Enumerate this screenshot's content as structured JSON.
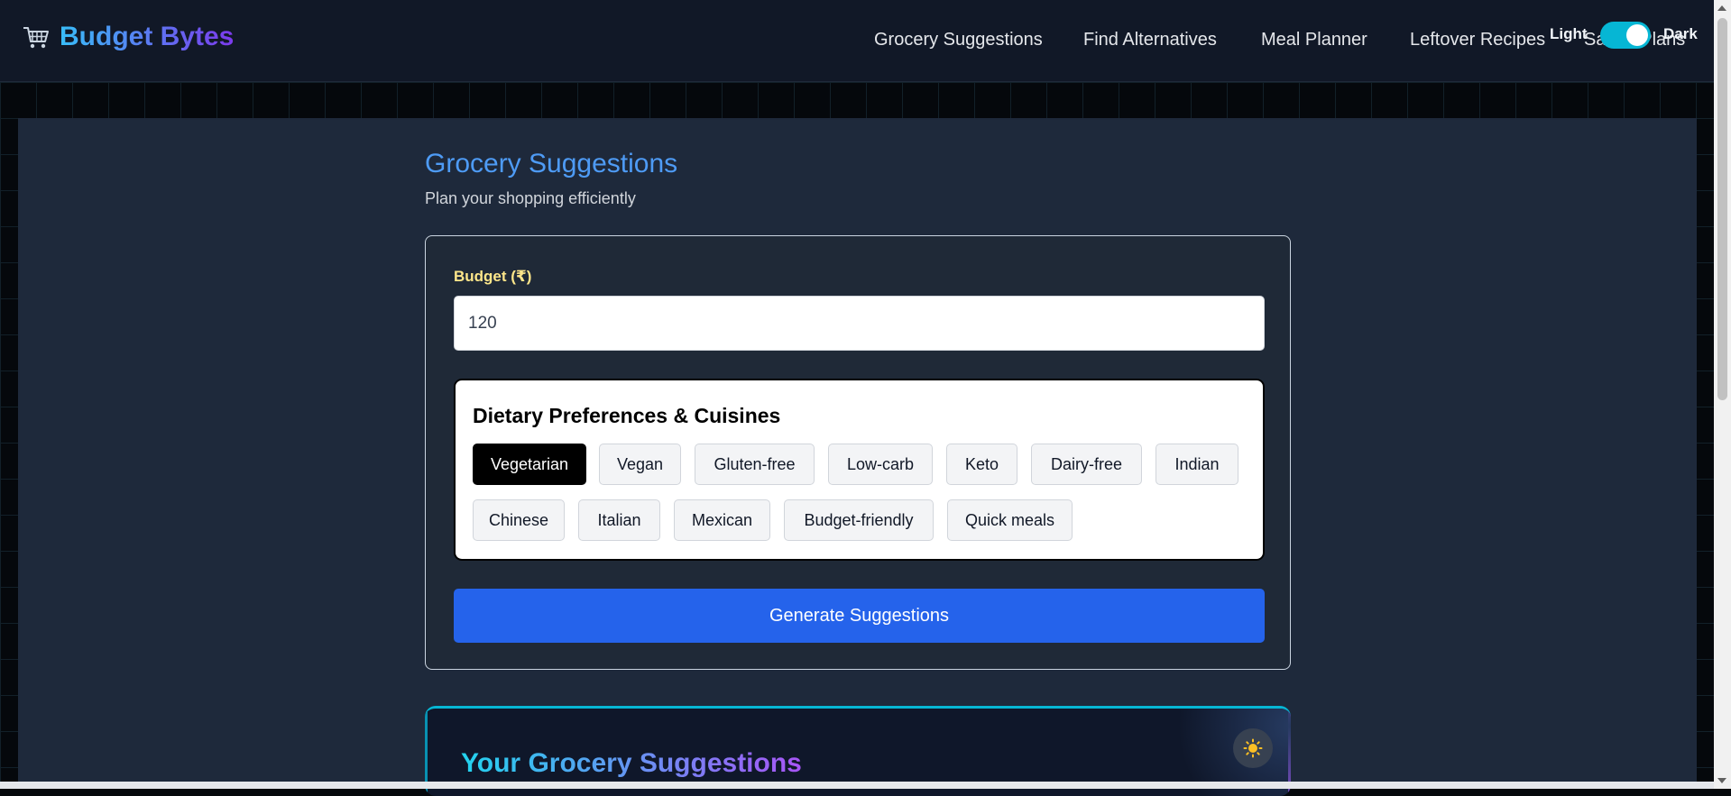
{
  "app": {
    "name": "Budget Bytes",
    "logo_icon": "shopping-cart-icon"
  },
  "nav": {
    "items": [
      {
        "label": "Grocery Suggestions"
      },
      {
        "label": "Find Alternatives"
      },
      {
        "label": "Meal Planner"
      },
      {
        "label": "Leftover Recipes"
      },
      {
        "label": "Saved Plans"
      }
    ]
  },
  "theme_toggle": {
    "light_label": "Light",
    "dark_label": "Dark",
    "state": "dark",
    "accent_color": "#06b6d4"
  },
  "page": {
    "title": "Grocery Suggestions",
    "subtitle": "Plan your shopping efficiently"
  },
  "form": {
    "budget_label": "Budget (₹)",
    "budget_value": "120",
    "preferences_title": "Dietary Preferences & Cuisines",
    "chips": [
      {
        "label": "Vegetarian",
        "selected": true
      },
      {
        "label": "Vegan",
        "selected": false
      },
      {
        "label": "Gluten-free",
        "selected": false
      },
      {
        "label": "Low-carb",
        "selected": false
      },
      {
        "label": "Keto",
        "selected": false
      },
      {
        "label": "Dairy-free",
        "selected": false
      },
      {
        "label": "Indian",
        "selected": false
      },
      {
        "label": "Chinese",
        "selected": false
      },
      {
        "label": "Italian",
        "selected": false
      },
      {
        "label": "Mexican",
        "selected": false
      },
      {
        "label": "Budget-friendly",
        "selected": false
      },
      {
        "label": "Quick meals",
        "selected": false
      }
    ],
    "generate_label": "Generate Suggestions",
    "button_color": "#2563eb"
  },
  "results": {
    "title": "Your Grocery Suggestions",
    "theme_button_icon": "sun-icon"
  }
}
